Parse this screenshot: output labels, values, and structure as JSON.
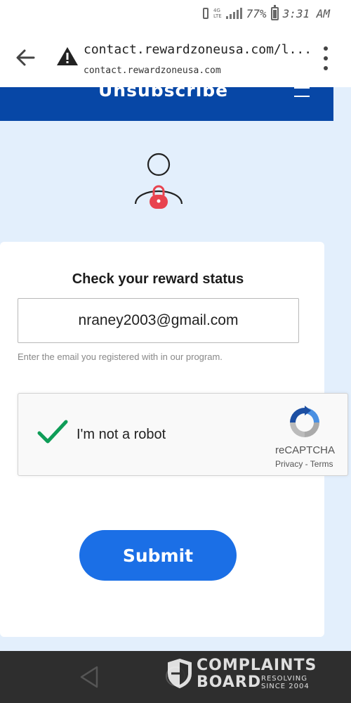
{
  "status_bar": {
    "network": "4G",
    "network_sub": "LTE",
    "battery": "77%",
    "battery_level": 0.77,
    "time": "3:31 AM"
  },
  "browser": {
    "url": "contact.rewardzoneusa.com/l...",
    "domain": "contact.rewardzoneusa.com",
    "security_icon": "warning-icon"
  },
  "site": {
    "title": "Unsubscribe"
  },
  "form": {
    "title": "Check your reward status",
    "email_value": "nraney2003@gmail.com",
    "helper": "Enter the email you registered with in our program.",
    "submit_label": "Submit"
  },
  "recaptcha": {
    "label": "I'm not a robot",
    "name": "reCAPTCHA",
    "links": "Privacy - Terms",
    "checked": true
  },
  "watermark": {
    "line1": "COMPLAINTS",
    "line2": "BOARD",
    "tag1": "RESOLVING",
    "tag2": "SINCE 2004"
  },
  "colors": {
    "header": "#0747a6",
    "page_bg": "#e3effc",
    "button": "#1b6fe6",
    "check": "#0f9d58",
    "lock": "#e8434f"
  }
}
